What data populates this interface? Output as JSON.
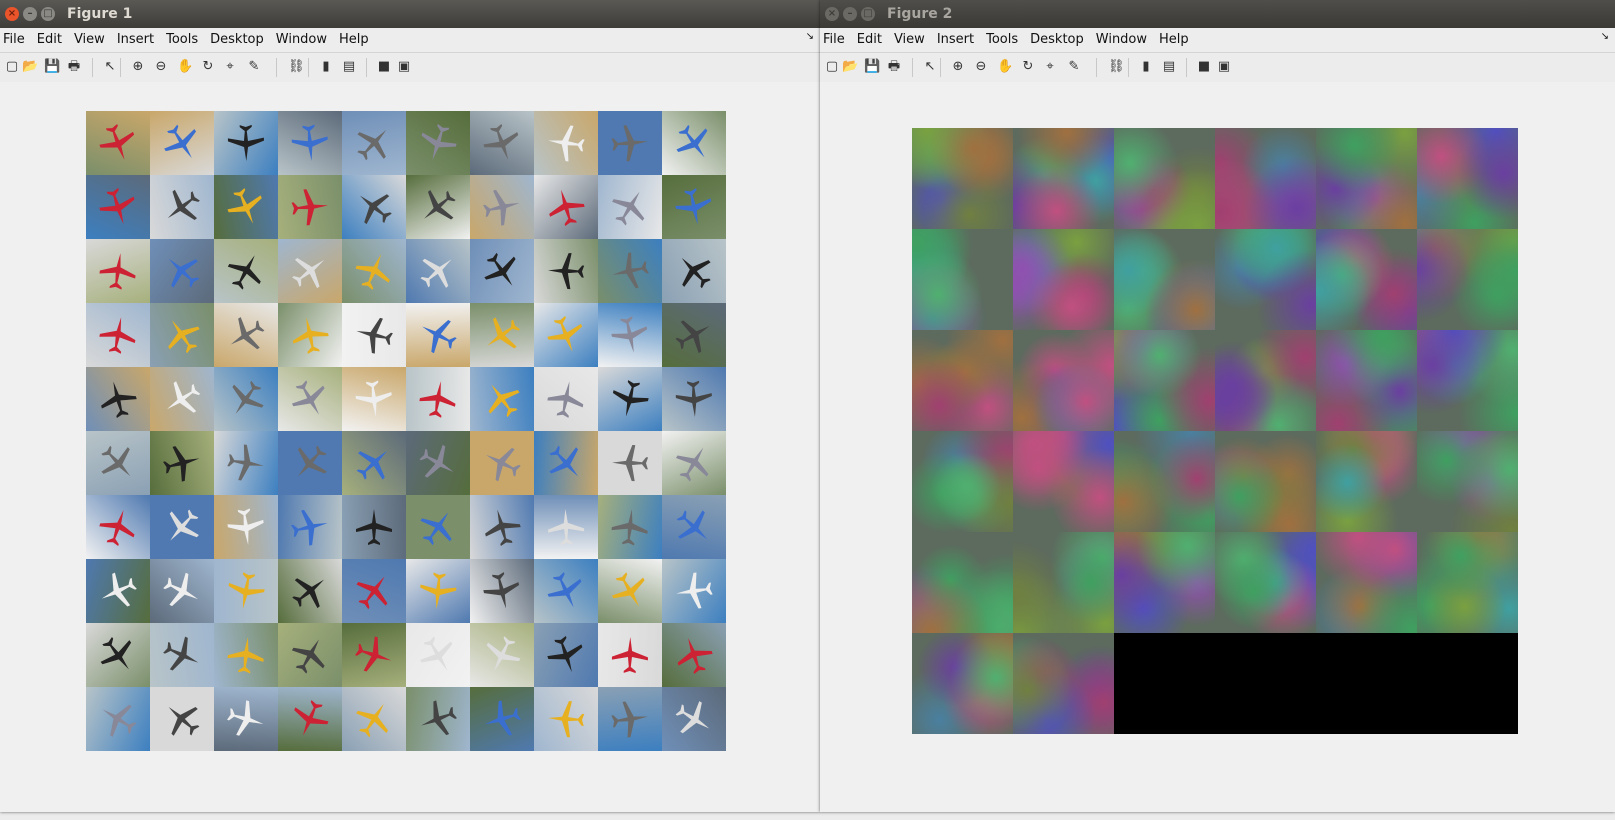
{
  "windows": [
    {
      "title": "Figure 1",
      "menu": [
        "File",
        "Edit",
        "View",
        "Insert",
        "Tools",
        "Desktop",
        "Window",
        "Help"
      ]
    },
    {
      "title": "Figure 2",
      "menu": [
        "File",
        "Edit",
        "View",
        "Insert",
        "Tools",
        "Desktop",
        "Window",
        "Help"
      ]
    }
  ],
  "toolbar_icons": [
    "new-figure-icon",
    "open-file-icon",
    "save-icon",
    "print-icon",
    "edit-plot-icon",
    "zoom-in-icon",
    "zoom-out-icon",
    "pan-icon",
    "rotate-3d-icon",
    "data-cursor-icon",
    "brush-icon",
    "link-plot-icon",
    "colorbar-icon",
    "legend-icon",
    "hide-plot-tools-icon",
    "show-plot-tools-icon"
  ],
  "figure1": {
    "image_type": "grid of 100 small airplane photographs (10x10)",
    "rows": 10,
    "cols": 10
  },
  "figure2": {
    "image_type": "grid of 32 colored noise-like filter visualizations (6x6, last 4 cells black)",
    "rows": 6,
    "cols": 6,
    "filled": 32,
    "empty_color": "#000000"
  }
}
